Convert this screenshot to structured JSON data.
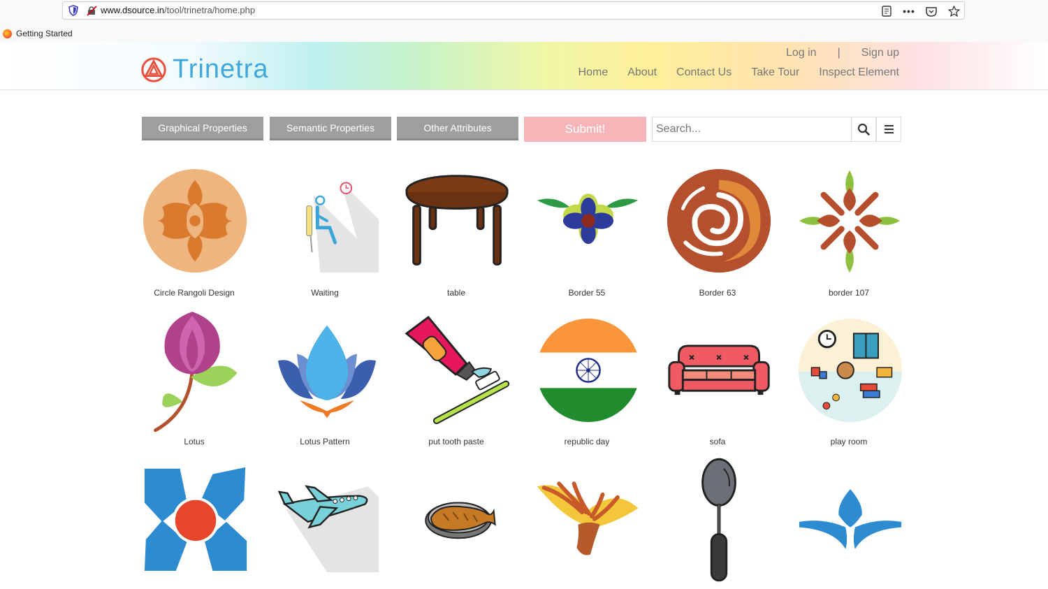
{
  "browser": {
    "url_host": "www.dsource.in",
    "url_path": "/tool/trinetra/home.php",
    "bookmark": "Getting Started",
    "icons": [
      "reader-view-icon",
      "more-icon",
      "pocket-icon",
      "bookmark-star-icon"
    ]
  },
  "site": {
    "brand": "Trinetra",
    "auth": {
      "login": "Log in",
      "sep": "|",
      "signup": "Sign up"
    },
    "nav": [
      "Home",
      "About",
      "Contact Us",
      "Take Tour",
      "Inspect Element"
    ]
  },
  "toolbar": {
    "graphical": "Graphical Properties",
    "semantic": "Semantic Properties",
    "other": "Other Attributes",
    "submit": "Submit!",
    "search_placeholder": "Search..."
  },
  "items": [
    {
      "label": "Circle Rangoli Design",
      "icon": "circle-rangoli-icon"
    },
    {
      "label": "Waiting",
      "icon": "waiting-icon"
    },
    {
      "label": "table",
      "icon": "table-icon"
    },
    {
      "label": "Border 55",
      "icon": "border-55-icon"
    },
    {
      "label": "Border 63",
      "icon": "border-63-icon"
    },
    {
      "label": "border 107",
      "icon": "border-107-icon"
    },
    {
      "label": "Lotus",
      "icon": "lotus-icon"
    },
    {
      "label": "Lotus Pattern",
      "icon": "lotus-pattern-icon"
    },
    {
      "label": "put tooth paste",
      "icon": "tooth-paste-icon"
    },
    {
      "label": "republic day",
      "icon": "republic-day-icon"
    },
    {
      "label": "sofa",
      "icon": "sofa-icon"
    },
    {
      "label": "play room",
      "icon": "play-room-icon"
    },
    {
      "label": "",
      "icon": "flower-pattern-icon"
    },
    {
      "label": "",
      "icon": "aeroplane-icon"
    },
    {
      "label": "",
      "icon": "fish-dish-icon"
    },
    {
      "label": "",
      "icon": "flower-border-icon"
    },
    {
      "label": "",
      "icon": "spoon-icon"
    },
    {
      "label": "",
      "icon": "border-pattern-icon"
    }
  ]
}
